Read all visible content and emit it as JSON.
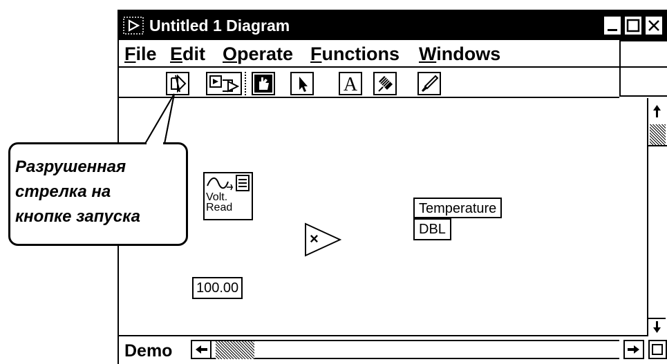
{
  "window": {
    "title": "Untitled 1 Diagram"
  },
  "menu": {
    "items": [
      "File",
      "Edit",
      "Operate",
      "Functions",
      "Windows"
    ]
  },
  "toolbar": {
    "tools": [
      {
        "icon": "broken-run-arrow-icon"
      },
      {
        "icon": "run-continuously-icon"
      },
      {
        "icon": "operate-hand-icon"
      },
      {
        "icon": "pointer-arrow-icon"
      },
      {
        "icon": "text-tool-icon"
      },
      {
        "icon": "wiring-spool-icon"
      },
      {
        "icon": "color-brush-icon"
      }
    ]
  },
  "diagram": {
    "volt_read_label_line1": "Volt.",
    "volt_read_label_line2": "Read",
    "temperature_label": "Temperature",
    "dbl_label": "DBL",
    "multiply_symbol": "×",
    "constant_value": "100.00"
  },
  "callout": {
    "line1": "Разрушенная",
    "line2": "стрелка на",
    "line3": "кнопке запуска"
  },
  "bottom": {
    "label": "Demo"
  }
}
